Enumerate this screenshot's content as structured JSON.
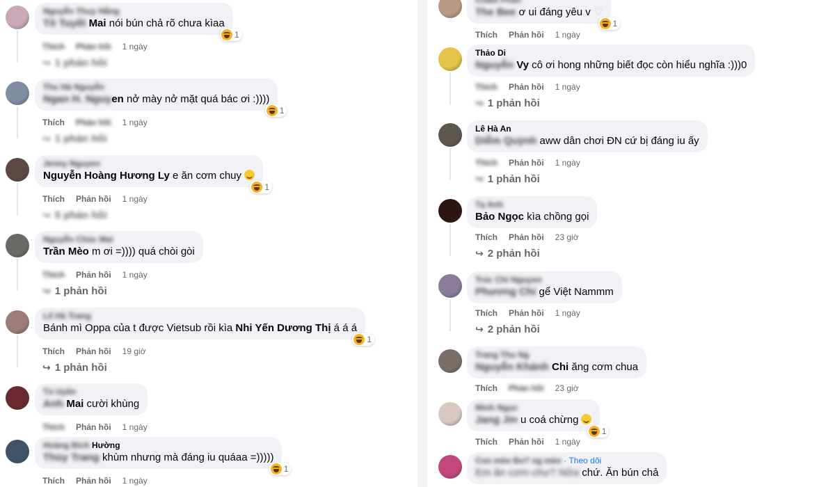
{
  "left": [
    {
      "author": "Nguyễn Thuy Hằng",
      "mention": "Tô Tuyết",
      "mention_clear": "Mai",
      "text": " nói bún chả rõ chưa kìaa",
      "reaction_count": "1",
      "like": "Thích",
      "reply": "Phản hồi",
      "time": "1 ngày",
      "replies": "1 phản hồi",
      "avatar_color": "#c9a9b8"
    },
    {
      "author": "Thu Hà Nguyễn",
      "mention": "Ngan H. Nguy",
      "mention_clear": "en",
      "text": " nở mày nở mặt quá bác ơi :))))",
      "reaction_count": "1",
      "like": "Thích",
      "reply": "Phản hồi",
      "time": "1 ngày",
      "replies": "1 phản hồi",
      "avatar_color": "#7f8ea3"
    },
    {
      "author": "Jenny Nguyen",
      "mention_clear": "Nguyễn Hoàng Hương Ly",
      "text": " e ăn cơm chuy",
      "reaction_count": "1",
      "like": "Thích",
      "reply": "Phản hồi",
      "time": "1 ngày",
      "replies": "5 phản hồi",
      "avatar_color": "#5b4a44"
    },
    {
      "author": "Nguyễn Chúc Mai",
      "mention_clear": "Trần Mèo",
      "text": " m ơi =)))) quá chòi gòi",
      "like": "Thích",
      "reply": "Phản hồi",
      "time": "1 ngày",
      "replies": "1 phản hồi",
      "avatar_color": "#6c6a65"
    },
    {
      "author": "Lê Hà Trang",
      "text_before": "Bánh mì Oppa của t được Vietsub rồi kìa ",
      "mention_clear": "Nhi Yến Dương Thị",
      "text": " á á á",
      "reaction_count": "1",
      "like": "Thích",
      "reply": "Phản hồi",
      "time": "19 giờ",
      "replies": "1 phản hồi",
      "avatar_color": "#9c7d78"
    },
    {
      "author": "Tú Uyên",
      "mention": "Anh",
      "mention_clear": "Mai",
      "text": " cười khùng",
      "like": "Thích",
      "reply": "Phản hồi",
      "time": "1 ngày",
      "avatar_color": "#6b2a2f"
    },
    {
      "author": "Hoàng Bích",
      "author_clear": "Hường",
      "mention": "Thùy Trang",
      "text": " khùm nhưng mà đáng iu quáaa =)))))",
      "reaction_count": "1",
      "like": "Thích",
      "reply": "Phản hồi",
      "time": "1 ngày",
      "avatar_color": "#3f5468"
    }
  ],
  "right": [
    {
      "author": "Châm Phan",
      "mention": "The Bee",
      "text": " ơ ui đáng yêu v",
      "reaction_count": "1",
      "like": "Thích",
      "reply": "Phản hồi",
      "time": "1 ngày",
      "avatar_color": "#b79a86"
    },
    {
      "author_clear": "Thảo Di",
      "mention": "Nguyễn",
      "mention_clear": "Vy",
      "text": " cô ơi hong những biết đọc còn hiểu nghĩa :)))0",
      "like": "Thích",
      "reply": "Phản hồi",
      "time": "1 ngày",
      "replies": "1 phản hồi",
      "avatar_color": "#e6c34a"
    },
    {
      "author_clear": "Lê Hà An",
      "mention": "Diễm Quỳnh",
      "text": " aww dân chơi ĐN cứ bị đáng iu ấy",
      "like": "Thích",
      "reply": "Phản hồi",
      "time": "1 ngày",
      "replies": "1 phản hồi",
      "avatar_color": "#5d5651"
    },
    {
      "author": "Tạ Anh",
      "mention_clear": "Bảo Ngọc",
      "text": " kìa chồng gọi",
      "like": "Thích",
      "reply": "Phản hồi",
      "time": "23 giờ",
      "replies": "2 phản hồi",
      "avatar_color": "#2e1414"
    },
    {
      "author": "Trúc Chi Nguyen",
      "mention": "Phương Chi",
      "text": " gể Việt Nammm",
      "like": "Thích",
      "reply": "Phản hồi",
      "time": "1 ngày",
      "replies": "2 phản hồi",
      "avatar_color": "#8a7c9b"
    },
    {
      "author": "Trang Thu Ng",
      "mention": "Nguyễn Khánh",
      "mention_clear": "Chi",
      "text": " ăng cơm chua",
      "like": "Thích",
      "reply": "Phản hồi",
      "time": "23 giờ",
      "avatar_color": "#7b6e66"
    },
    {
      "author": "Minh Ngọc",
      "mention": "Jang Jin",
      "text": " u coá chừng",
      "reaction_count": "1",
      "like": "Thích",
      "reply": "Phản hồi",
      "time": "1 ngày",
      "avatar_color": "#d8c7c2"
    },
    {
      "author": "Con mèo Đo? ng mèo",
      "follow": "· Theo dõi",
      "mention": "Em ăn cơm chư? Nữa",
      "text": " chứ. Ăn bún chả",
      "avatar_color": "#c2487a"
    }
  ]
}
